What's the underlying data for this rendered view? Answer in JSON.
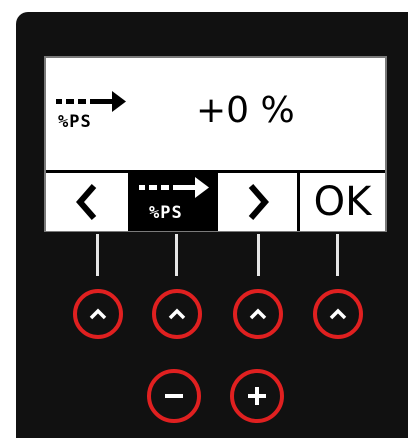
{
  "display": {
    "mode_unit": "%PS",
    "value": "+0 %"
  },
  "softkeys": {
    "prev_icon": "chevron-left-icon",
    "mode_unit": "%PS",
    "next_icon": "chevron-right-icon",
    "ok_label": "OK"
  },
  "buttons": {
    "up_icon": "chevron-up-icon",
    "minus_icon": "minus-icon",
    "plus_icon": "plus-icon"
  },
  "colors": {
    "device_body": "#111111",
    "button_ring": "#e02020",
    "screen_bg": "#ffffff",
    "screen_text": "#000000"
  }
}
